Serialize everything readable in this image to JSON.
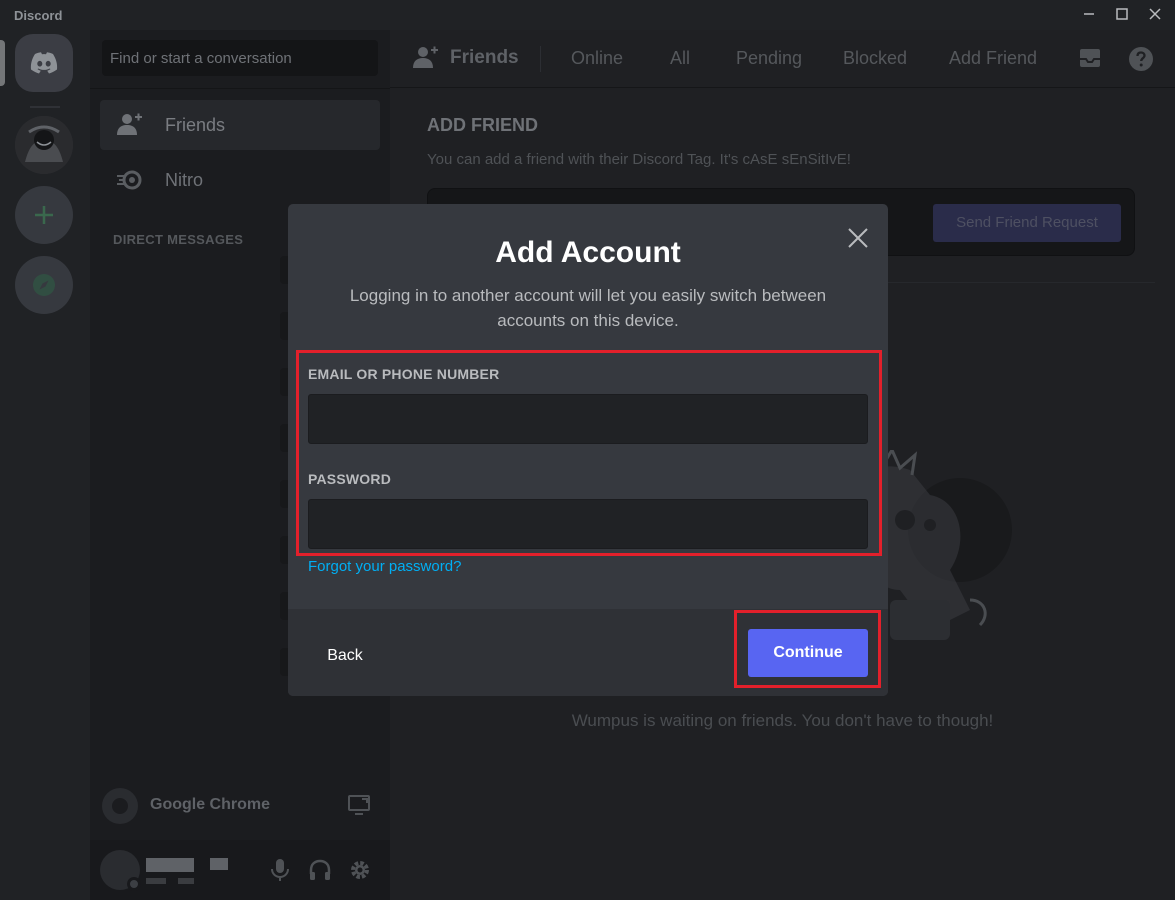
{
  "window": {
    "app_name": "Discord"
  },
  "sidebar": {
    "search_placeholder": "Find or start a conversation",
    "items": [
      {
        "label": "Friends"
      },
      {
        "label": "Nitro"
      }
    ],
    "dm_header": "DIRECT MESSAGES",
    "activity": {
      "label": "Google Chrome"
    }
  },
  "topbar": {
    "title": "Friends",
    "tabs": [
      "Online",
      "All",
      "Pending",
      "Blocked",
      "Add Friend"
    ]
  },
  "add_friend": {
    "title": "ADD FRIEND",
    "subtitle": "You can add a friend with their Discord Tag. It's cAsE sEnSitIvE!",
    "send_button": "Send Friend Request"
  },
  "empty_state": "Wumpus is waiting on friends. You don't have to though!",
  "modal": {
    "title": "Add Account",
    "subtitle": "Logging in to another account will let you easily switch between accounts on this device.",
    "email_label": "EMAIL OR PHONE NUMBER",
    "email_value": "",
    "password_label": "PASSWORD",
    "password_value": "",
    "forgot": "Forgot your password?",
    "back": "Back",
    "continue": "Continue"
  },
  "colors": {
    "blurple": "#5865f2",
    "link": "#00aff4",
    "highlight": "#e3202b"
  }
}
